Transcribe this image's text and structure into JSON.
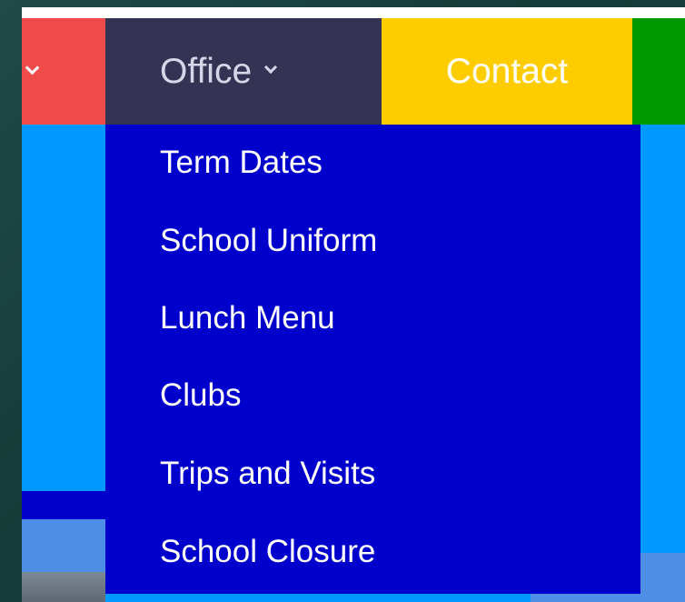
{
  "nav": {
    "office_label": "Office",
    "contact_label": "Contact"
  },
  "dropdown": {
    "items": [
      {
        "label": "Term Dates"
      },
      {
        "label": "School Uniform"
      },
      {
        "label": "Lunch Menu"
      },
      {
        "label": "Clubs"
      },
      {
        "label": "Trips and Visits"
      },
      {
        "label": "School Closure"
      }
    ]
  },
  "colors": {
    "nav_red": "#ef4b4b",
    "nav_office": "#353353",
    "nav_contact": "#ffcc00",
    "nav_green": "#009900",
    "dropdown_bg": "#0000cc",
    "page_bg": "#0099ff"
  },
  "icons": {
    "dropdown_chevron": "chevron-down-icon"
  }
}
